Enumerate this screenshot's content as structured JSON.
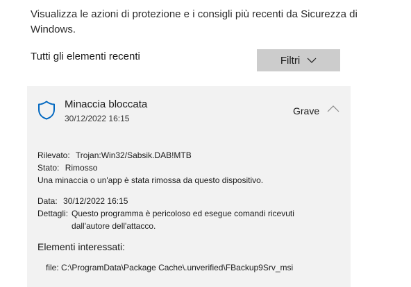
{
  "intro_text": "Visualizza le azioni di protezione e i consigli più recenti da Sicurezza di Windows.",
  "recent_label": "Tutti gli elementi recenti",
  "filter_button": {
    "label": "Filtri",
    "icon": "chevron-down-icon"
  },
  "threat": {
    "icon": "shield-icon",
    "title": "Minaccia bloccata",
    "datetime": "30/12/2022 16:15",
    "severity": "Grave",
    "expanded_icon": "chevron-up-icon",
    "accent_color": "#0067c0",
    "detected_label": "Rilevato:",
    "detected_value": "Trojan:Win32/Sabsik.DAB!MTB",
    "status_label": "Stato:",
    "status_value": "Rimosso",
    "status_message": "Una minaccia o un'app è stata rimossa da questo dispositivo.",
    "date_label": "Data:",
    "date_value": "30/12/2022 16:15",
    "details_label": "Dettagli:",
    "details_value": "Questo programma è pericoloso ed esegue comandi ricevuti dall'autore dell'attacco.",
    "affected_title": "Elementi interessati:",
    "affected_file_label": "file:",
    "affected_file_path": "C:\\ProgramData\\Package Cache\\.unverified\\FBackup9Srv_msi"
  }
}
